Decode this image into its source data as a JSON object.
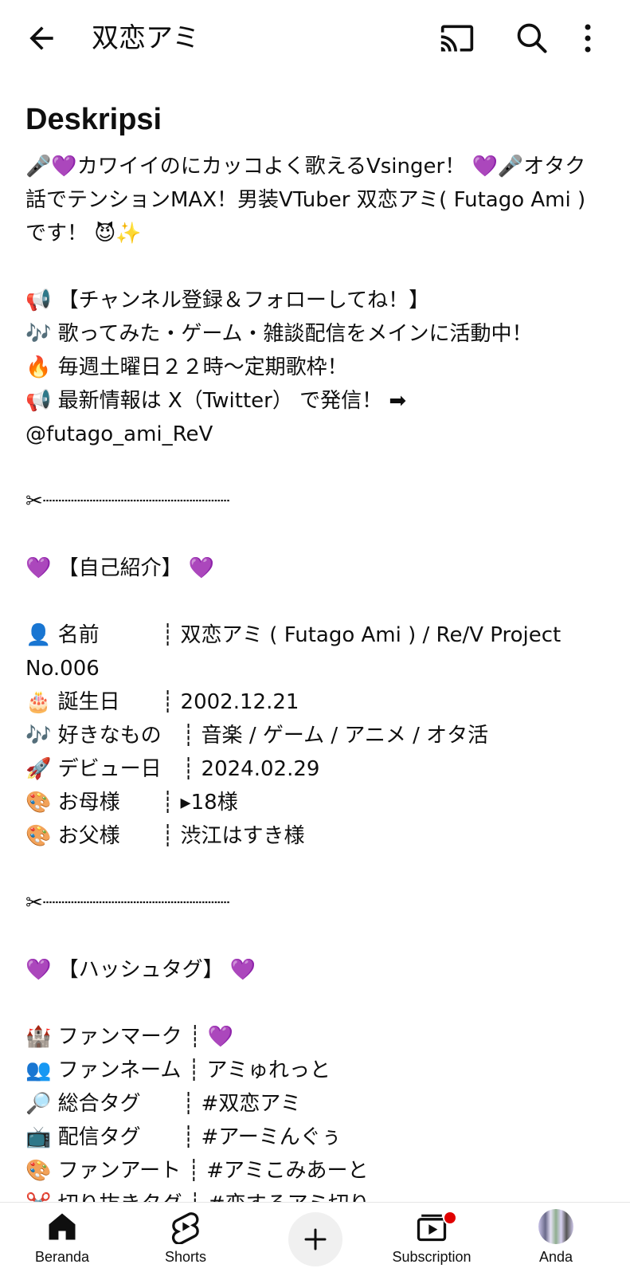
{
  "header": {
    "title": "双恋アミ"
  },
  "description": {
    "heading": "Deskripsi",
    "text": "🎤💜カワイイのにカッコよく歌えるVsinger！ 💜🎤オタク話でテンションMAX！男装VTuber 双恋アミ( Futago Ami )です！ 😈✨\n\n📢 【チャンネル登録＆フォローしてね！】\n🎶 歌ってみた・ゲーム・雑談配信をメインに活動中！\n🔥 毎週土曜日２２時〜定期歌枠！\n📢 最新情報は X（Twitter） で発信！ ➡ @futago_ami_ReV\n\n✂┈┈┈┈┈┈┈┈┈┈┈┈┈┈┈\n\n💜 【自己紹介】 💜\n\n👤 名前　　　┊ 双恋アミ ( Futago Ami ) / Re/V Project No.006\n🎂 誕生日　　┊ 2002.12.21\n🎶 好きなもの　┊ 音楽 / ゲーム / アニメ / オタ活\n🚀 デビュー日　┊ 2024.02.29\n🎨 お母様　　┊ ▸18様\n🎨 お父様　　┊ 渋江はすき様\n\n✂┈┈┈┈┈┈┈┈┈┈┈┈┈┈┈\n\n💜 【ハッシュタグ】 💜\n\n🏰 ファンマーク ┊ 💜\n👥 ファンネーム ┊ アミゅれっと\n🔎 総合タグ　　┊ #双恋アミ\n📺 配信タグ　　┊ #アーミんぐぅ\n🎨 ファンアート ┊ #アミこみあーと\n✂️ 切り抜きタグ ┊ #恋するアミ切り"
  },
  "bottom_nav": {
    "home": "Beranda",
    "shorts": "Shorts",
    "subscriptions": "Subscription",
    "you": "Anda"
  },
  "icons": {
    "back": "arrow-back-icon",
    "cast": "cast-icon",
    "search": "search-icon",
    "more": "more-vert-icon",
    "home": "home-icon",
    "shorts": "shorts-icon",
    "create": "plus-icon",
    "subscriptions": "subscriptions-icon"
  },
  "colors": {
    "text": "#0f0f0f",
    "notification_badge": "#e00000"
  }
}
